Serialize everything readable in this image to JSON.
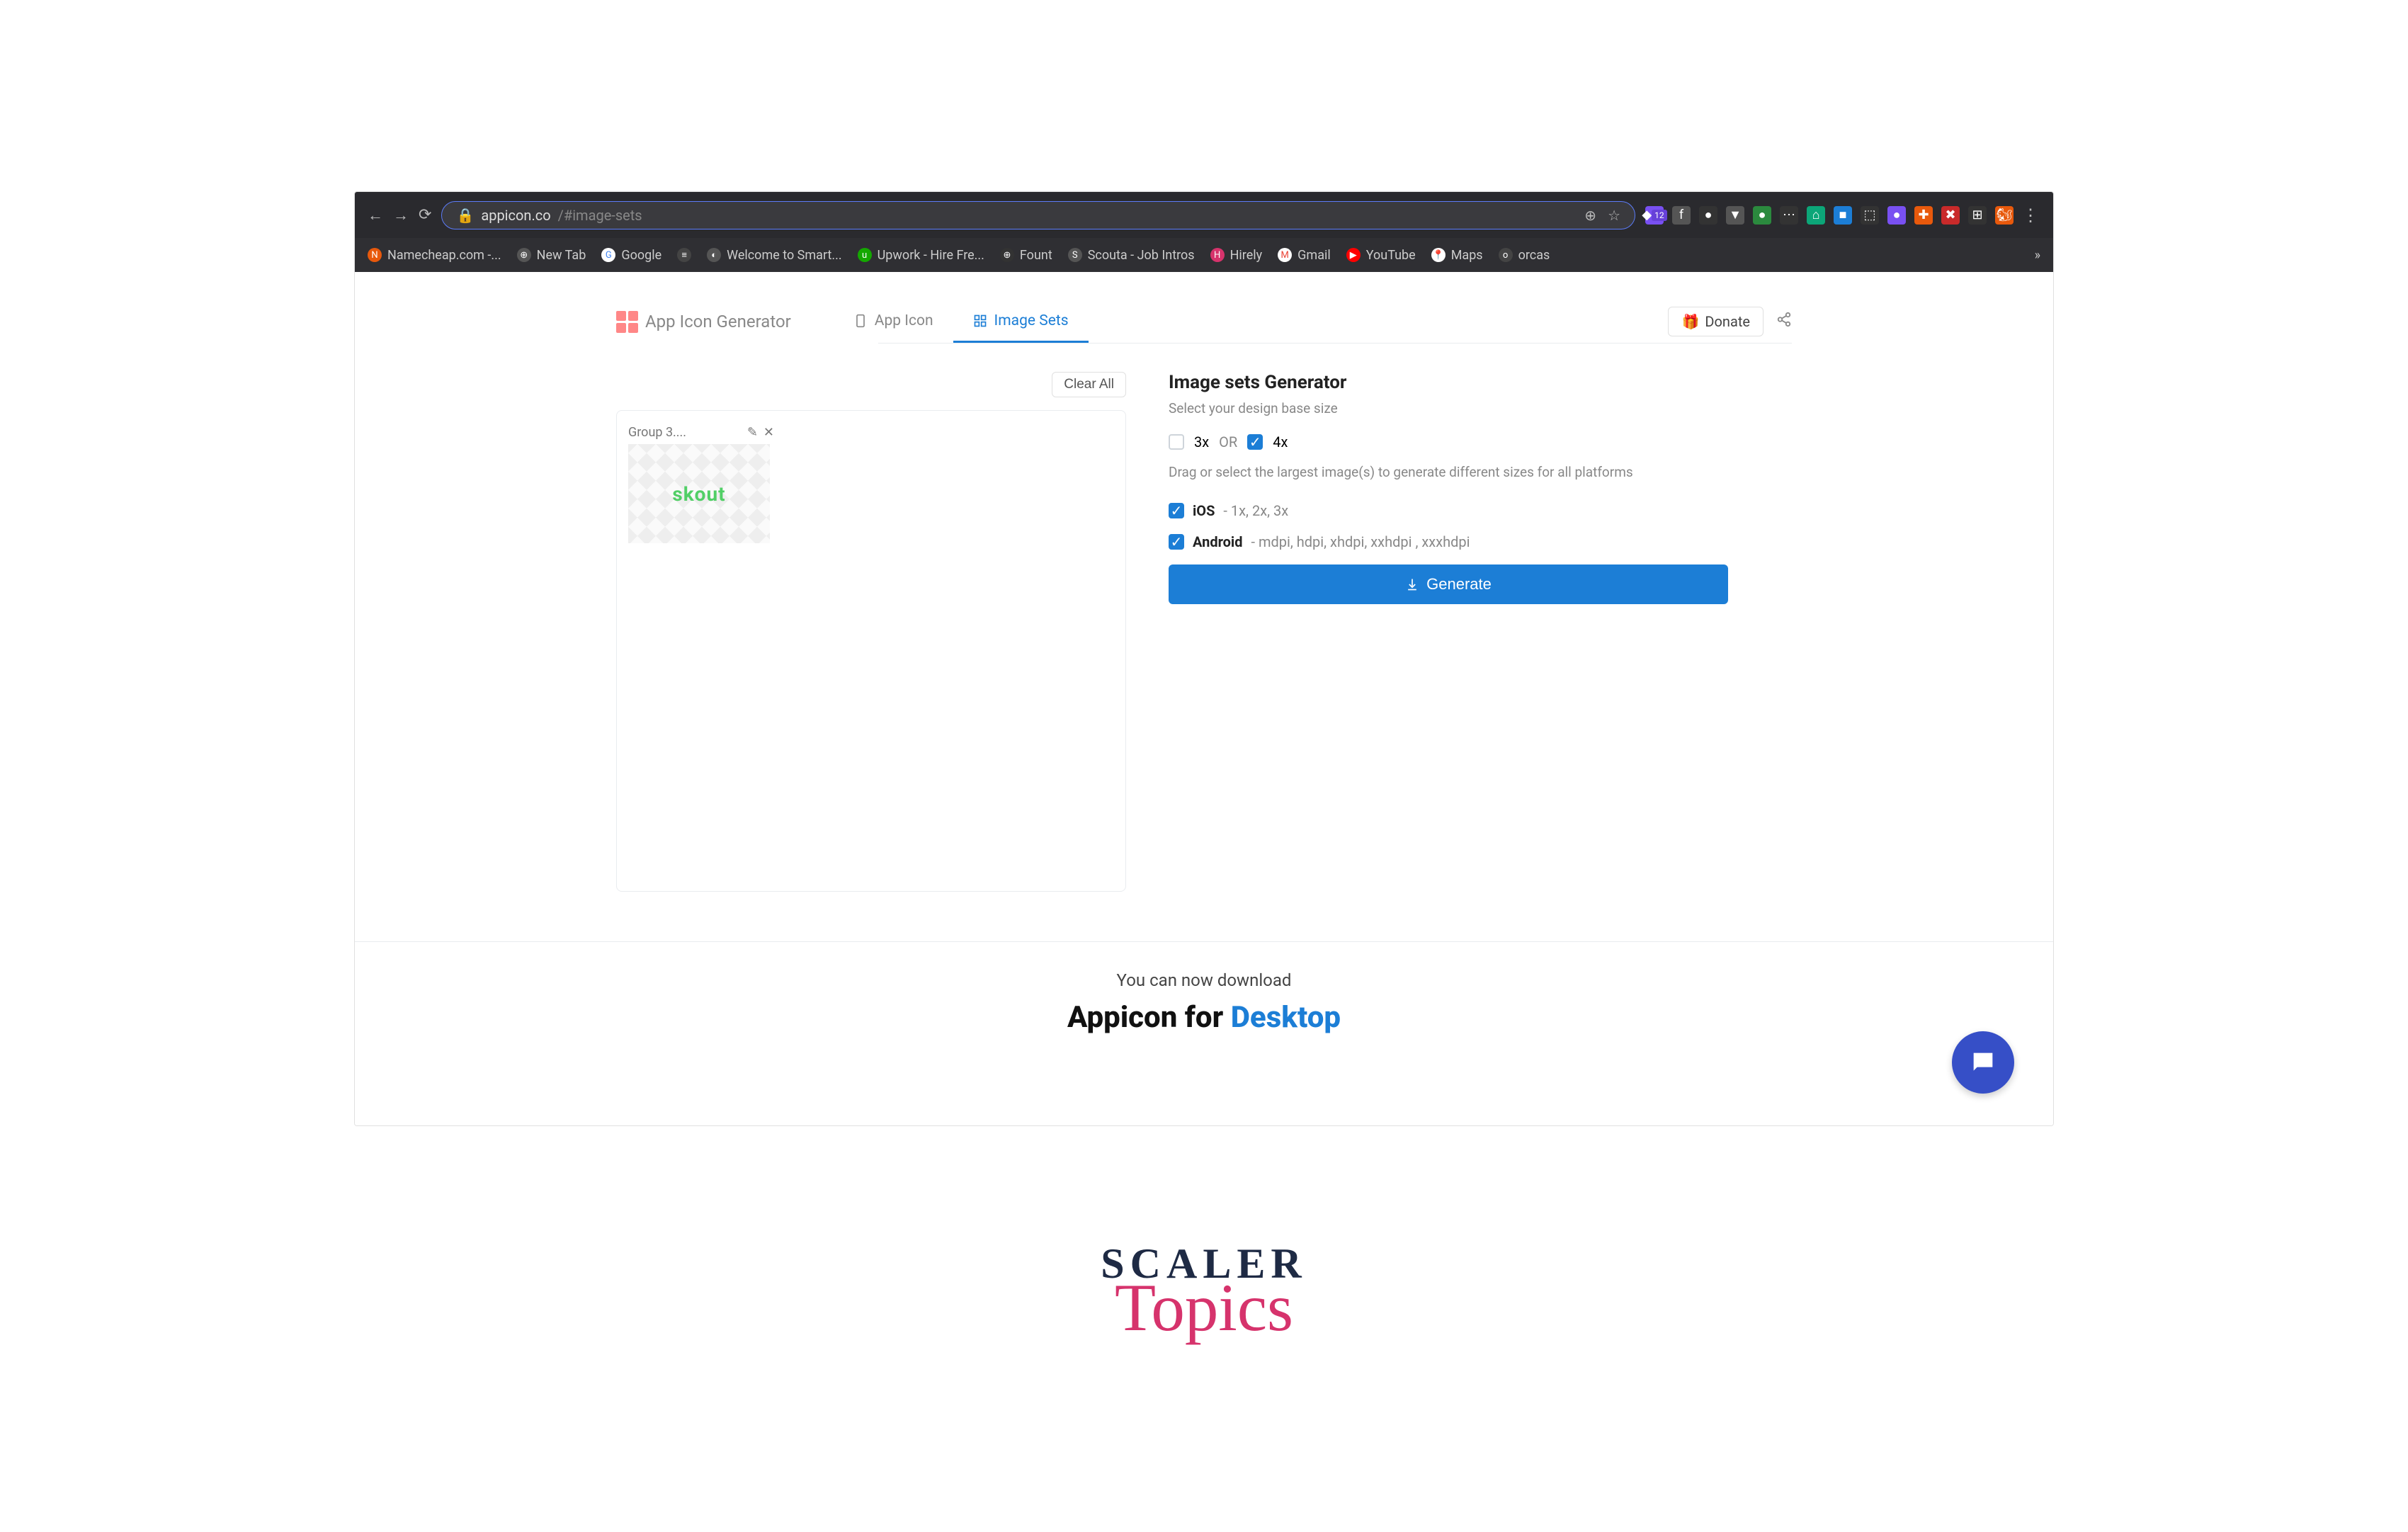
{
  "browser": {
    "url_host": "appicon.co",
    "url_path": "/#image-sets",
    "ext_badge": "12"
  },
  "bookmarks": [
    {
      "label": "Namecheap.com -...",
      "cls": "bm-nc",
      "glyph": "N"
    },
    {
      "label": "New Tab",
      "cls": "bm-white",
      "glyph": "⊕"
    },
    {
      "label": "Google",
      "cls": "bm-g",
      "glyph": "G"
    },
    {
      "label": "",
      "cls": "bm-fav",
      "glyph": "≡"
    },
    {
      "label": "Welcome to Smart...",
      "cls": "bm-white",
      "glyph": "◐"
    },
    {
      "label": "Upwork - Hire Fre...",
      "cls": "bm-up",
      "glyph": "u"
    },
    {
      "label": "Fount",
      "cls": "bm-ff",
      "glyph": "⊕"
    },
    {
      "label": "Scouta - Job Intros",
      "cls": "bm-s",
      "glyph": "S"
    },
    {
      "label": "Hirely",
      "cls": "bm-h",
      "glyph": "H"
    },
    {
      "label": "Gmail",
      "cls": "bm-gm",
      "glyph": "M"
    },
    {
      "label": "YouTube",
      "cls": "bm-yt",
      "glyph": "▶"
    },
    {
      "label": "Maps",
      "cls": "bm-map",
      "glyph": "📍"
    },
    {
      "label": "orcas",
      "cls": "bm-or",
      "glyph": "o"
    }
  ],
  "header": {
    "brand": "App Icon Generator",
    "tab_app_icon": "App Icon",
    "tab_image_sets": "Image Sets",
    "donate": "Donate"
  },
  "left": {
    "clear_all": "Clear All",
    "thumb_name": "Group 3....",
    "thumb_logo": "skout"
  },
  "right": {
    "title": "Image sets Generator",
    "subtitle": "Select your design base size",
    "opt_3x": "3x",
    "opt_or": "OR",
    "opt_4x": "4x",
    "desc": "Drag or select the largest image(s) to generate different sizes for all platforms",
    "ios_label": "iOS",
    "ios_detail": " - 1x, 2x, 3x",
    "android_label": "Android",
    "android_detail": " - mdpi, hdpi, xhdpi, xxhdpi , xxxhdpi",
    "generate": "Generate"
  },
  "promo": {
    "small": "You can now download",
    "big_a": "Appicon for ",
    "big_b": "Desktop"
  },
  "scaler": {
    "line1": "SCALER",
    "line2": "Topics"
  }
}
